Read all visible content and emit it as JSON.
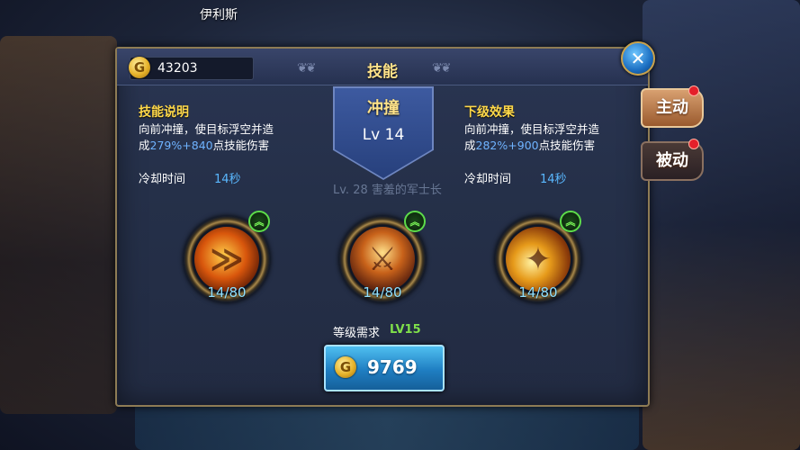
{
  "world": {
    "player_name": "伊利斯"
  },
  "currency": {
    "gold": "43203",
    "coin_glyph": "G"
  },
  "dialog": {
    "title": "技能",
    "close_symbol": "✕",
    "title_ornament": "❦❦"
  },
  "tabs": [
    {
      "label": "主动",
      "active": true
    },
    {
      "label": "被动",
      "active": false
    }
  ],
  "skill": {
    "name": "冲撞",
    "level": "Lv 14"
  },
  "current": {
    "heading": "技能说明",
    "desc_line1": "向前冲撞，使目标浮空并造",
    "desc_prefix": "成",
    "desc_pct": "279%",
    "desc_flat": "+840",
    "desc_suffix": "点技能伤害",
    "cooldown_label": "冷却时间",
    "cooldown_value": "14秒"
  },
  "next": {
    "heading": "下级效果",
    "desc_line1": "向前冲撞，使目标浮空并造",
    "desc_prefix": "成",
    "desc_pct": "282%",
    "desc_flat": "+900",
    "desc_suffix": "点技能伤害",
    "cooldown_label": "冷却时间",
    "cooldown_value": "14秒"
  },
  "background_text": {
    "line1": "Lv. 28 害羞的军士长"
  },
  "slots": [
    {
      "count": "14/80",
      "icon": "dash-skill-icon"
    },
    {
      "count": "14/80",
      "icon": "warrior-skill-icon"
    },
    {
      "count": "14/80",
      "icon": "fire-strike-skill-icon"
    }
  ],
  "upgrade_symbol": "︽",
  "requirement": {
    "label": "等级需求",
    "value": "LV15"
  },
  "upgrade": {
    "cost": "9769"
  },
  "colors": {
    "accent_gold": "#ffd94a",
    "highlight_blue": "#6fb3ff",
    "req_green": "#7fe04a"
  }
}
